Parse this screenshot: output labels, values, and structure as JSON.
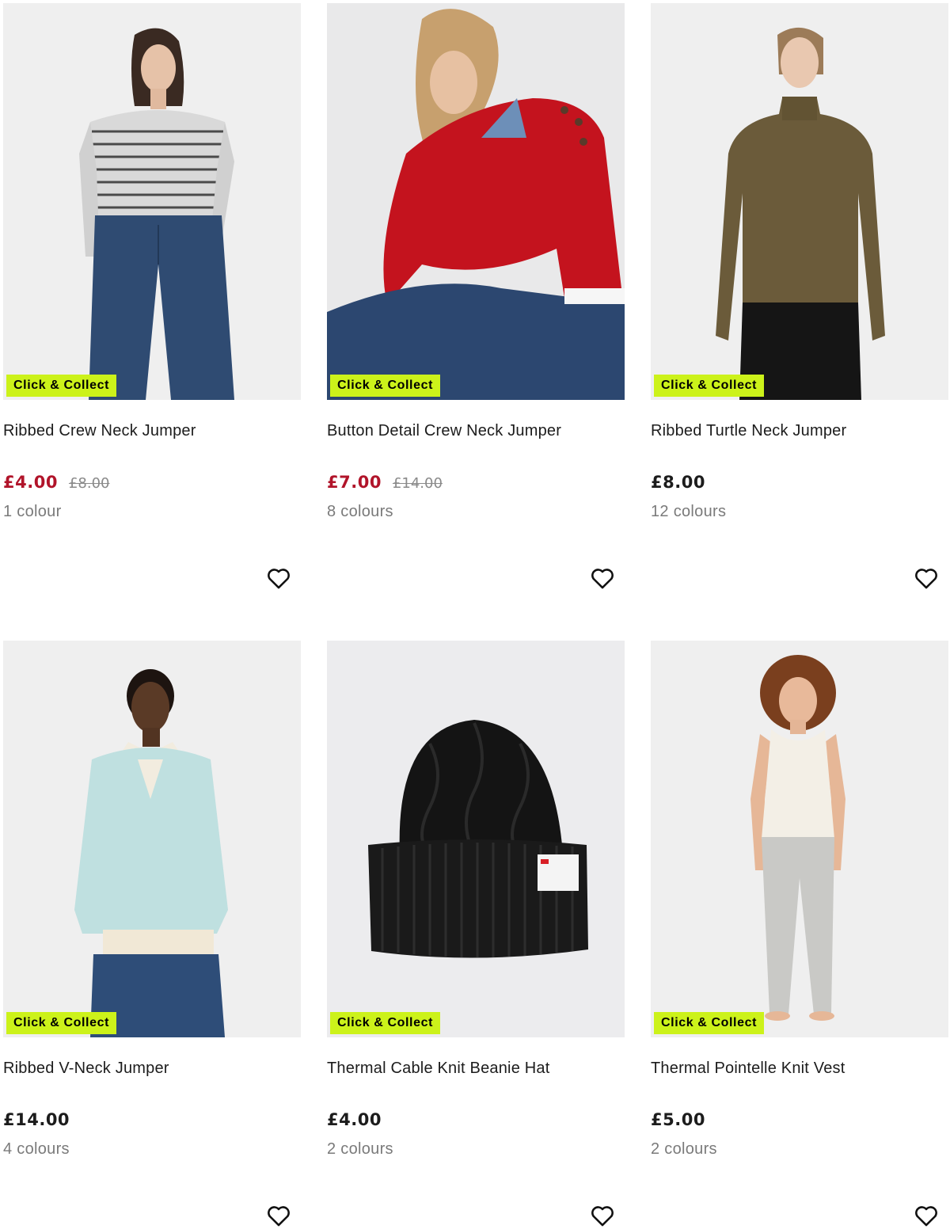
{
  "products": [
    {
      "badge": "Click & Collect",
      "title": "Ribbed Crew Neck Jumper",
      "price": "£4.00",
      "was_price": "£8.00",
      "on_sale": true,
      "colours": "1 colour",
      "wishlist_icon": "heart-outline-icon",
      "image": "woman-striped-jumper-jeans"
    },
    {
      "badge": "Click & Collect",
      "title": "Button Detail Crew Neck Jumper",
      "price": "£7.00",
      "was_price": "£14.00",
      "on_sale": true,
      "colours": "8 colours",
      "wishlist_icon": "heart-outline-icon",
      "image": "woman-red-jumper-seated"
    },
    {
      "badge": "Click & Collect",
      "title": "Ribbed Turtle Neck Jumper",
      "price": "£8.00",
      "was_price": "",
      "on_sale": false,
      "colours": "12 colours",
      "wishlist_icon": "heart-outline-icon",
      "image": "woman-khaki-turtle-neck"
    },
    {
      "badge": "Click & Collect",
      "title": "Ribbed V-Neck Jumper",
      "price": "£14.00",
      "was_price": "",
      "on_sale": false,
      "colours": "4 colours",
      "wishlist_icon": "heart-outline-icon",
      "image": "woman-mint-v-neck"
    },
    {
      "badge": "Click & Collect",
      "title": "Thermal Cable Knit Beanie Hat",
      "price": "£4.00",
      "was_price": "",
      "on_sale": false,
      "colours": "2 colours",
      "wishlist_icon": "heart-outline-icon",
      "image": "black-cable-beanie"
    },
    {
      "badge": "Click & Collect",
      "title": "Thermal Pointelle Knit Vest",
      "price": "£5.00",
      "was_price": "",
      "on_sale": false,
      "colours": "2 colours",
      "wishlist_icon": "heart-outline-icon",
      "image": "woman-white-vest-grey-leggings"
    }
  ],
  "colors": {
    "badge_bg": "#ccf21a",
    "sale_price": "#b1142a",
    "image_bg": "#efefef"
  }
}
